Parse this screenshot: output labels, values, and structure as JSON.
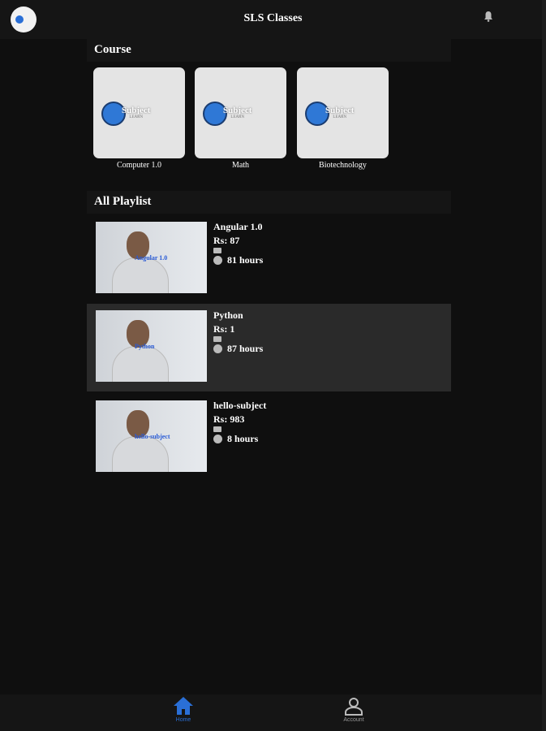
{
  "header": {
    "title": "SLS Classes"
  },
  "course_section": {
    "title": "Course",
    "items": [
      {
        "label": "Computer 1.0",
        "brand": "Subject",
        "brand_sub": "LEARN"
      },
      {
        "label": "Math",
        "brand": "Subject",
        "brand_sub": "LEARN"
      },
      {
        "label": "Biotechnology",
        "brand": "Subject",
        "brand_sub": "LEARN"
      }
    ]
  },
  "playlist_section": {
    "title": "All Playlist",
    "items": [
      {
        "name": "Angular 1.0",
        "price": "Rs: 87",
        "duration": "81 hours",
        "thumb_tag": "Angular 1.0"
      },
      {
        "name": "Python",
        "price": "Rs: 1",
        "duration": "87 hours",
        "thumb_tag": "Python"
      },
      {
        "name": "hello-subject",
        "price": "Rs: 983",
        "duration": "8 hours",
        "thumb_tag": "hello-subject"
      }
    ]
  },
  "bottom_nav": {
    "home": "Home",
    "account": "Account"
  },
  "colors": {
    "accent": "#2a6fd6"
  }
}
